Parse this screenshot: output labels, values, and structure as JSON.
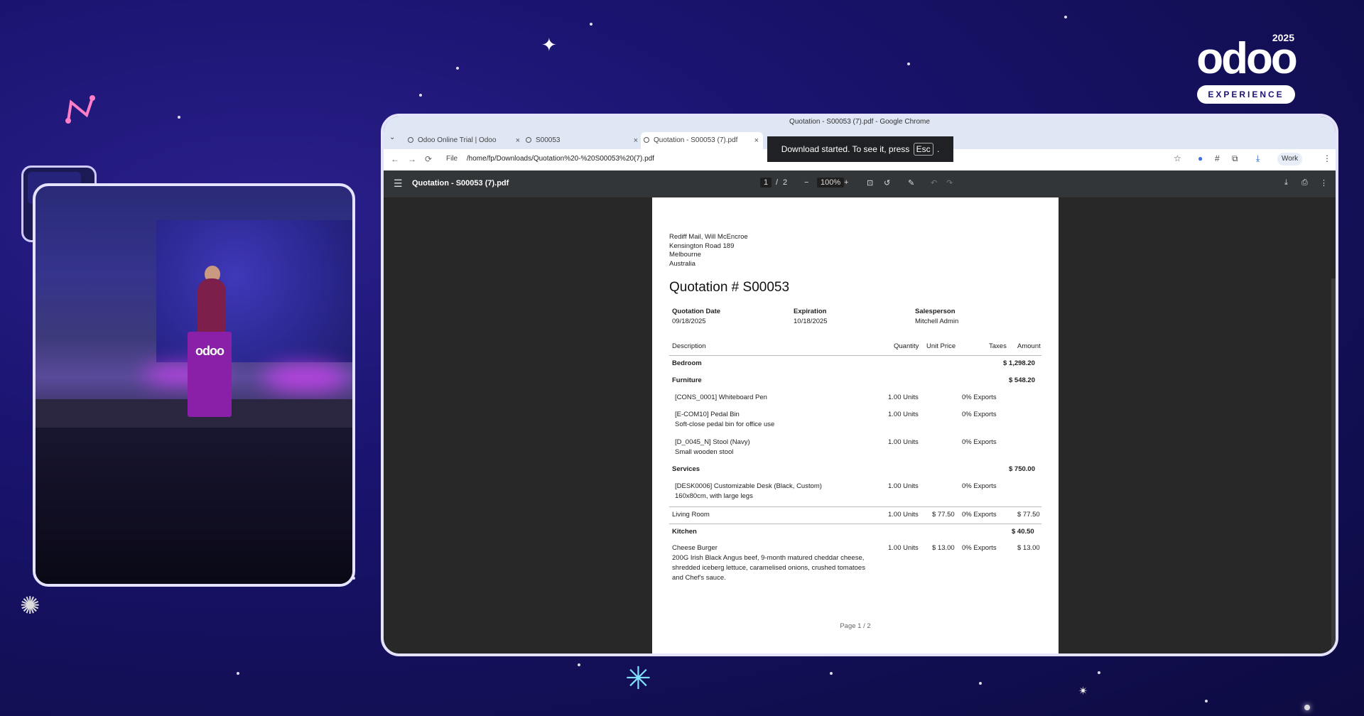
{
  "brand": {
    "logo": "odoo",
    "year": "2025",
    "tagline": "EXPERIENCE"
  },
  "video": {
    "podium_label": "odoo"
  },
  "browser": {
    "window_title": "Quotation - S00053 (7).pdf - Google Chrome",
    "tabs": [
      {
        "label": "Odoo Online Trial | Odoo",
        "close": "×"
      },
      {
        "label": "S00053",
        "close": "×"
      },
      {
        "label": "Quotation - S00053 (7).pdf",
        "close": "×"
      }
    ],
    "tab_dropdown": "⌄",
    "nav": {
      "back": "←",
      "forward": "→",
      "reload": "⟳"
    },
    "url_prefix": "File",
    "url": "/home/fp/Downloads/Quotation%20-%20S00053%20(7).pdf",
    "profile_label": "Work",
    "toast": {
      "text_before": "Download started. To see it, press",
      "key": "Esc",
      "text_after": "."
    }
  },
  "pdf_viewer": {
    "file_name": "Quotation - S00053 (7).pdf",
    "page_current": "1",
    "page_total": "2",
    "page_sep": "/",
    "zoom": "100%",
    "zoom_out": "−",
    "zoom_in": "+"
  },
  "document": {
    "address": [
      "Rediff Mail, Will McEncroe",
      "Kensington Road 189",
      "Melbourne",
      "Australia"
    ],
    "title": "Quotation # S00053",
    "meta": [
      {
        "label": "Quotation Date",
        "value": "09/18/2025"
      },
      {
        "label": "Expiration",
        "value": "10/18/2025"
      },
      {
        "label": "Salesperson",
        "value": "Mitchell Admin"
      }
    ],
    "columns": [
      "Description",
      "Quantity",
      "Unit Price",
      "Taxes",
      "Amount"
    ],
    "rows": [
      {
        "desc": "Bedroom",
        "amount": "$ 1,298.20",
        "bold": true
      },
      {
        "desc": "Furniture",
        "amount": "$ 548.20",
        "bold": true
      },
      {
        "desc": "[CONS_0001] Whiteboard Pen",
        "qty": "1.00 Units",
        "taxes": "0% Exports"
      },
      {
        "desc": "[E-COM10] Pedal Bin",
        "note": "Soft-close pedal bin for office use",
        "qty": "1.00 Units",
        "taxes": "0% Exports"
      },
      {
        "desc": "[D_0045_N] Stool (Navy)",
        "note": "Small wooden stool",
        "qty": "1.00 Units",
        "taxes": "0% Exports"
      },
      {
        "desc": "Services",
        "amount": "$ 750.00",
        "bold": true
      },
      {
        "desc": "[DESK0006] Customizable Desk (Black, Custom)",
        "note": "160x80cm, with large legs",
        "qty": "1.00 Units",
        "taxes": "0% Exports"
      },
      {
        "desc": "Living Room",
        "qty": "1.00 Units",
        "price": "$ 77.50",
        "taxes": "0% Exports",
        "amount": "$ 77.50"
      },
      {
        "desc": "Kitchen",
        "amount": "$ 40.50",
        "bold": true
      },
      {
        "desc": "Cheese Burger",
        "note": "200G Irish Black Angus beef, 9-month matured cheddar cheese,",
        "note2": "shredded iceberg lettuce, caramelised onions, crushed tomatoes",
        "note3": "and Chef's sauce.",
        "qty": "1.00 Units",
        "price": "$ 13.00",
        "taxes": "0% Exports",
        "amount": "$ 13.00"
      }
    ],
    "footer": "Page 1 / 2"
  }
}
